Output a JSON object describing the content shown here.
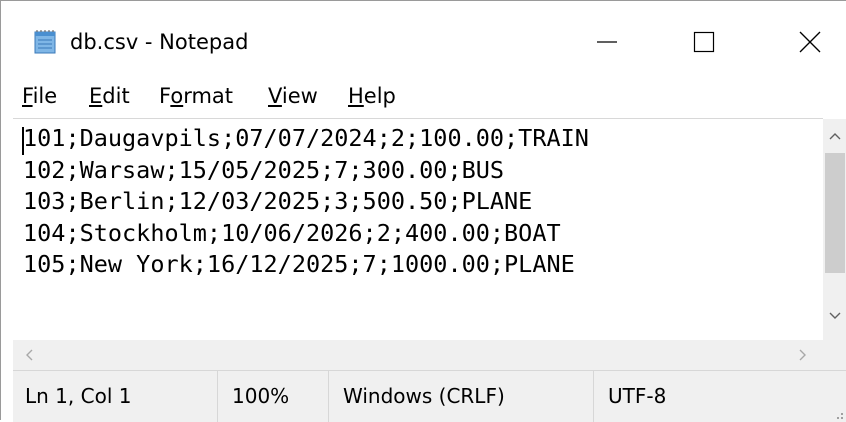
{
  "window": {
    "title": "db.csv - Notepad",
    "icons": {
      "app": "notepad-icon",
      "minimize": "minimize-icon",
      "maximize": "maximize-icon",
      "close": "close-icon"
    }
  },
  "menu": {
    "items": [
      {
        "key": "file",
        "accel": "F",
        "rest": "ile"
      },
      {
        "key": "edit",
        "accel": "E",
        "rest": "dit"
      },
      {
        "key": "format",
        "pre": "F",
        "accel": "o",
        "rest": "rmat"
      },
      {
        "key": "view",
        "accel": "V",
        "rest": "iew"
      },
      {
        "key": "help",
        "accel": "H",
        "rest": "elp"
      }
    ]
  },
  "editor": {
    "lines": [
      "101;Daugavpils;07/07/2024;2;100.00;TRAIN",
      "102;Warsaw;15/05/2025;7;300.00;BUS",
      "103;Berlin;12/03/2025;3;500.50;PLANE",
      "104;Stockholm;10/06/2026;2;400.00;BOAT",
      "105;New York;16/12/2025;7;1000.00;PLANE"
    ]
  },
  "statusbar": {
    "position": "Ln 1, Col 1",
    "zoom": "100%",
    "line_ending": "Windows (CRLF)",
    "encoding": "UTF-8"
  },
  "colors": {
    "chrome": "#f0f0f0",
    "scroll_thumb": "#cdcdcd",
    "text": "#000000"
  }
}
